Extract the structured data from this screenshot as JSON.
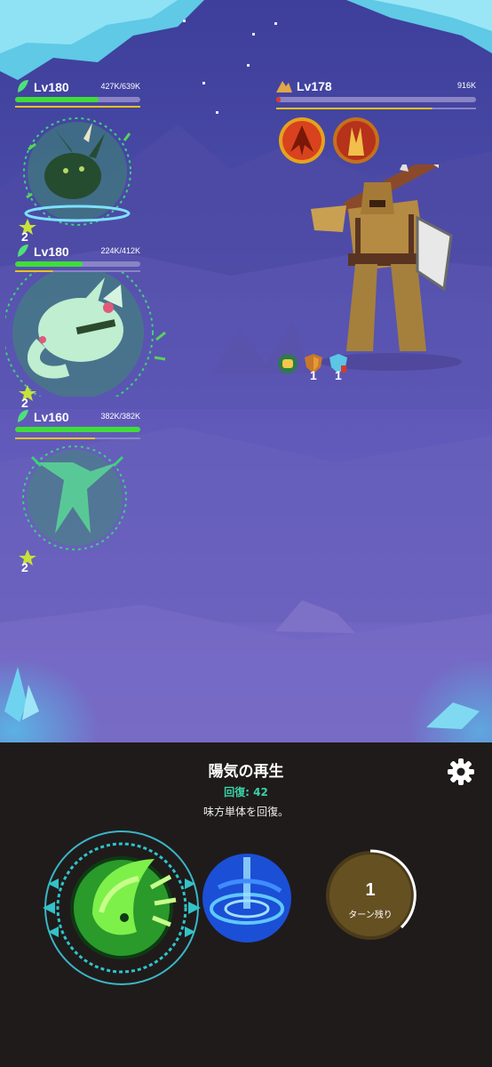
{
  "allies": [
    {
      "level": "Lv180",
      "hp": "427K/639K",
      "hp_fraction": 0.67,
      "charge_fraction": 1.0,
      "buff_count": "2"
    },
    {
      "level": "Lv180",
      "hp": "224K/412K",
      "hp_fraction": 0.54,
      "charge_fraction": 0.3,
      "buff_count": "2"
    },
    {
      "level": "Lv160",
      "hp": "382K/382K",
      "hp_fraction": 1.0,
      "charge_fraction": 0.64,
      "buff_count": "2"
    }
  ],
  "enemy": {
    "level": "Lv178",
    "hp": "916K",
    "hp_fraction": 0.02,
    "charge_fraction": 0.78,
    "status": [
      {
        "icon": "fist-icon",
        "count": ""
      },
      {
        "icon": "shield-icon",
        "count": "1"
      },
      {
        "icon": "crystal-shield-icon",
        "count": "1"
      }
    ]
  },
  "skill": {
    "name": "陽気の再生",
    "heal_label": "回復: 42",
    "description": "味方単体を回復。"
  },
  "cooldown": {
    "turns": "1",
    "label": "ターン残り"
  },
  "colors": {
    "hp_green": "#3fdd3a",
    "charge_yellow": "#e8c21c",
    "enemy_hp": "#d83a2a",
    "panel_bg": "#1f1b1b",
    "heal_teal": "#3bd1a6"
  }
}
